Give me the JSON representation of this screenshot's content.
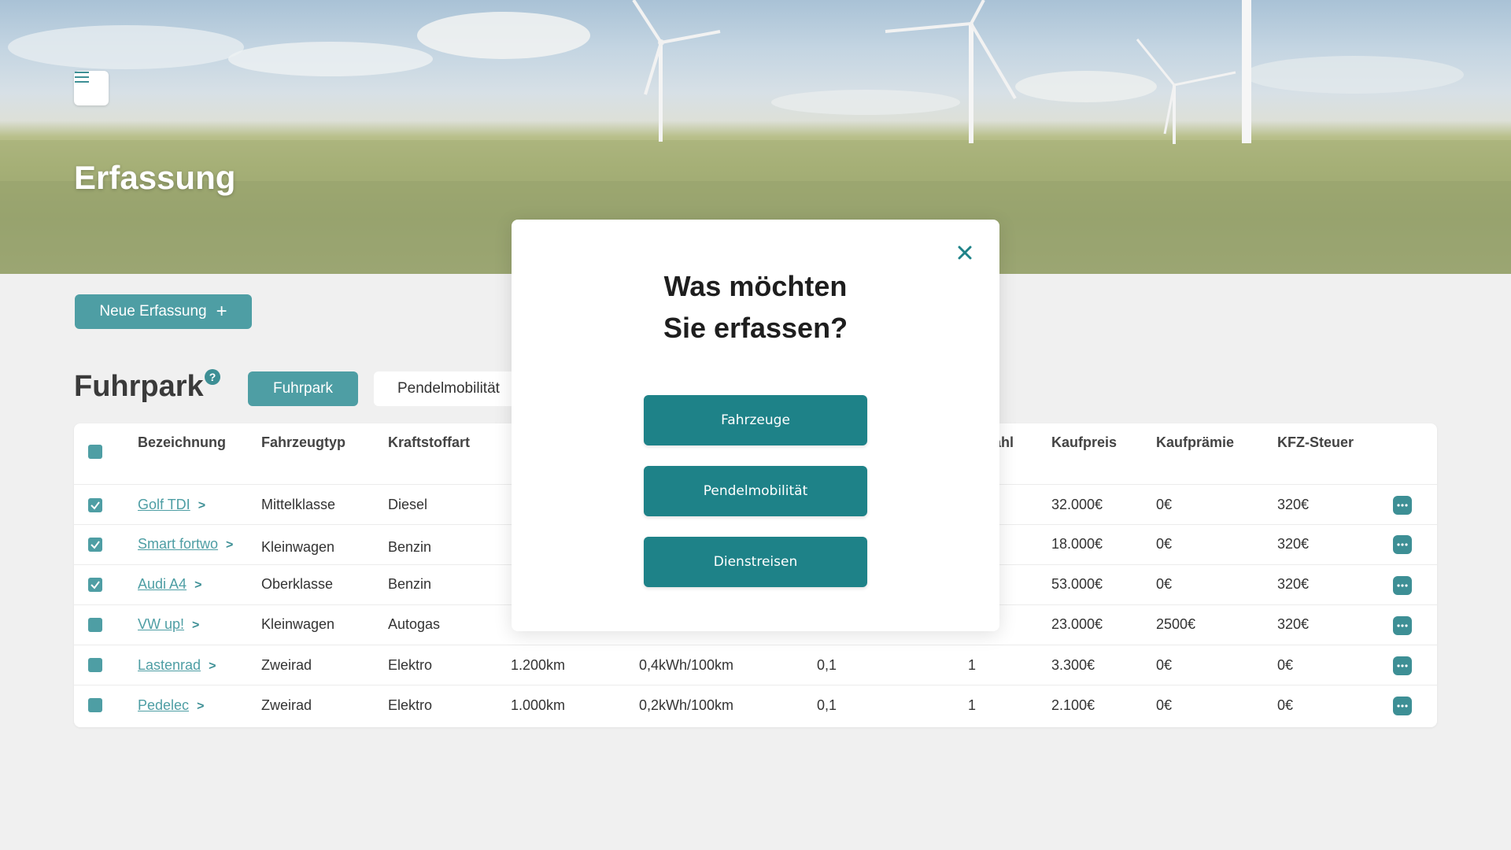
{
  "header": {
    "title": "Erfassung"
  },
  "new_entry_button": "Neue Erfassung",
  "section": {
    "title": "Fuhrpark",
    "help": "?",
    "tabs": [
      "Fuhrpark",
      "Pendelmobilität"
    ]
  },
  "table": {
    "columns": [
      "Bezeichnung",
      "Fahrzeugtyp",
      "Kraftstoffart",
      "ahl",
      "Kaufpreis",
      "Kaufprämie",
      "KFZ-Steuer"
    ],
    "rows": [
      {
        "name": "Golf TDI",
        "type": "Mittelklasse",
        "fuel": "Diesel",
        "km": "",
        "consumption": "",
        "factor": "",
        "count": "",
        "price": "32.000€",
        "bonus": "0€",
        "tax": "320€",
        "checked": true
      },
      {
        "name": "Smart fortwo",
        "type": "Kleinwagen",
        "fuel": "Benzin",
        "km": "",
        "consumption": "",
        "factor": "",
        "count": "",
        "price": "18.000€",
        "bonus": "0€",
        "tax": "320€",
        "checked": true
      },
      {
        "name": "Audi A4",
        "type": "Oberklasse",
        "fuel": "Benzin",
        "km": "",
        "consumption": "",
        "factor": "",
        "count": "",
        "price": "53.000€",
        "bonus": "0€",
        "tax": "320€",
        "checked": true
      },
      {
        "name": "VW up!",
        "type": "Kleinwagen",
        "fuel": "Autogas",
        "km": "",
        "consumption": "",
        "factor": "",
        "count": "",
        "price": "23.000€",
        "bonus": "2500€",
        "tax": "320€",
        "checked": false
      },
      {
        "name": "Lastenrad",
        "type": "Zweirad",
        "fuel": "Elektro",
        "km": "1.200km",
        "consumption": "0,4kWh/100km",
        "factor": "0,1",
        "count": "1",
        "price": "3.300€",
        "bonus": "0€",
        "tax": "0€",
        "checked": false
      },
      {
        "name": "Pedelec",
        "type": "Zweirad",
        "fuel": "Elektro",
        "km": "1.000km",
        "consumption": "0,2kWh/100km",
        "factor": "0,1",
        "count": "1",
        "price": "2.100€",
        "bonus": "0€",
        "tax": "0€",
        "checked": false
      }
    ]
  },
  "modal": {
    "title_line1": "Was möchten",
    "title_line2": "Sie erfassen?",
    "options": [
      "Fahrzeuge",
      "Pendelmobilität",
      "Dienstreisen"
    ]
  },
  "colors": {
    "accent": "#4e9ea4",
    "modal_button": "#1e8288",
    "icon": "#3d8f95"
  },
  "icons": [
    "menu-icon",
    "plus-icon",
    "help-icon",
    "checkbox-icon",
    "chevron-right-icon",
    "more-icon",
    "close-icon"
  ]
}
